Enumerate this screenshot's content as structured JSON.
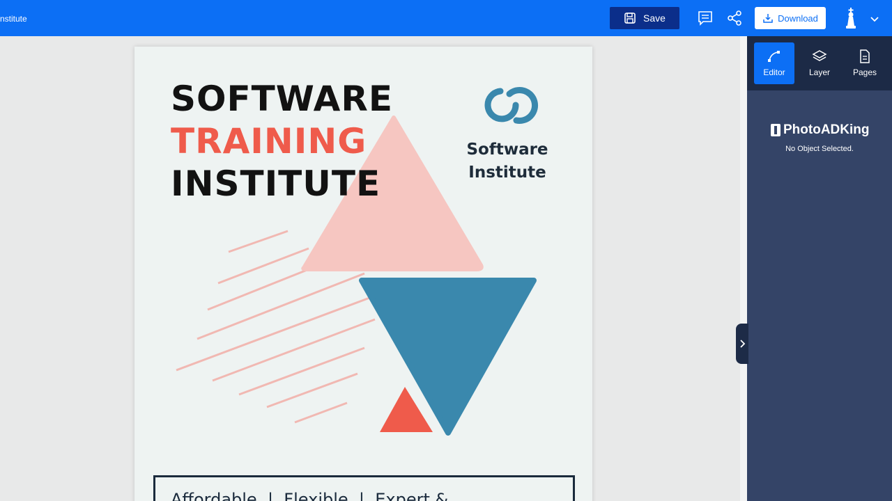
{
  "header": {
    "doc_title": "nstitute",
    "save_label": "Save",
    "download_label": "Download"
  },
  "poster": {
    "line1": "SOFTWARE",
    "line2": "TRAINING",
    "line3": "INSTITUTE",
    "logo_line1": "Software",
    "logo_line2": "Institute",
    "footer_text": "Affordable  |  Flexible  |  Expert &"
  },
  "panel": {
    "tabs": [
      {
        "label": "Editor",
        "icon": "editor-icon"
      },
      {
        "label": "Layer",
        "icon": "layers-icon"
      },
      {
        "label": "Pages",
        "icon": "pages-icon"
      }
    ],
    "brand": "PhotoADKing",
    "status": "No Object Selected."
  },
  "colors": {
    "topbar": "#0c6ff5",
    "save_bg": "#0b2e8a",
    "panel_bg": "#344467",
    "panel_tabs_bg": "#1c2a46",
    "accent_red": "#ef5b4b",
    "triangle_pink": "#f6c6c1",
    "triangle_blue": "#3a88ad"
  }
}
